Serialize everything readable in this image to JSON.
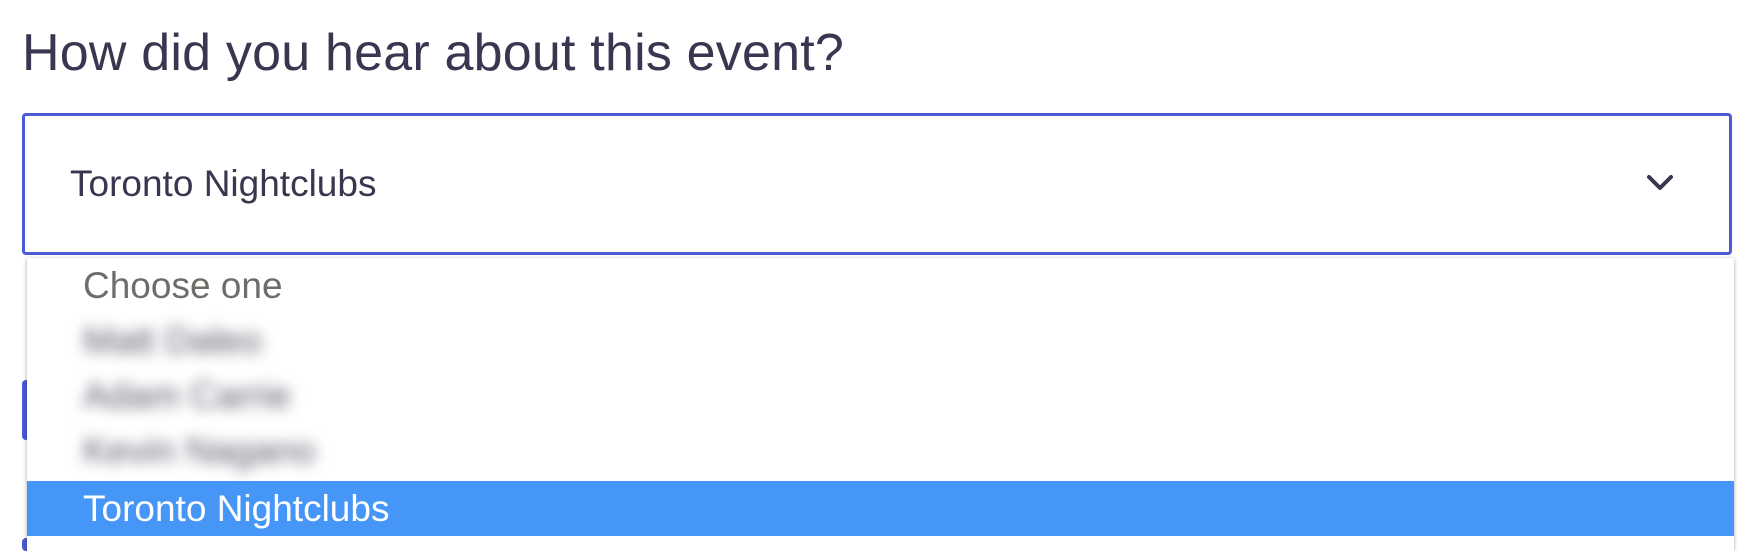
{
  "question": {
    "label": "How did you hear about this event?"
  },
  "select": {
    "value": "Toronto Nightclubs",
    "chevron_icon": "chevron-down-icon"
  },
  "dropdown": {
    "options": [
      {
        "label": "Choose one",
        "state": "placeholder"
      },
      {
        "label": "Matt Daleo",
        "state": "blurred"
      },
      {
        "label": "Adam Carrie",
        "state": "blurred"
      },
      {
        "label": "Kevin Nagano",
        "state": "blurred"
      },
      {
        "label": "Toronto Nightclubs",
        "state": "selected"
      }
    ]
  },
  "colors": {
    "focus_border": "#4b5ad6",
    "highlight": "#4596f7",
    "text": "#39364f",
    "placeholder": "#6f6d6a"
  }
}
